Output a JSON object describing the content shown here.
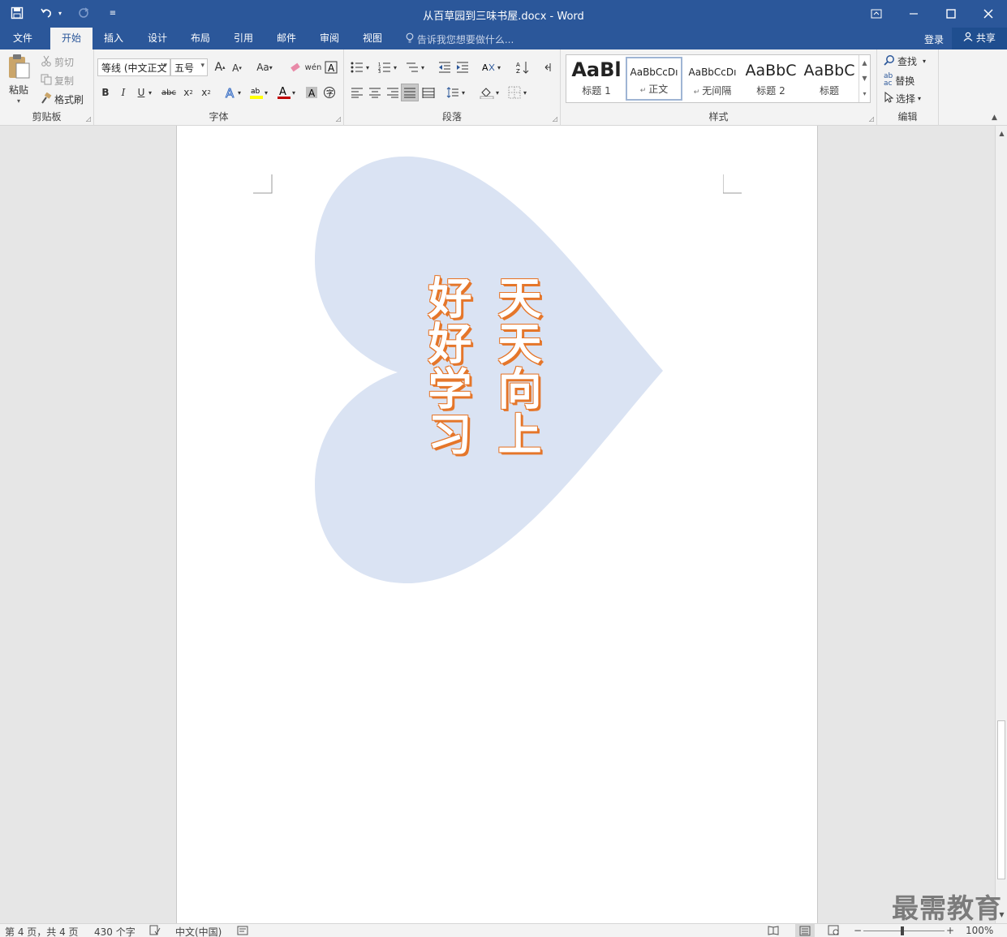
{
  "window": {
    "title": "从百草园到三味书屋.docx - Word",
    "controls": [
      "restore-ribbon",
      "minimize",
      "maximize",
      "close"
    ]
  },
  "qat": {
    "icons": [
      "save-icon",
      "undo-icon",
      "redo-icon",
      "customize-icon"
    ]
  },
  "tabs": [
    {
      "label": "文件"
    },
    {
      "label": "开始"
    },
    {
      "label": "插入"
    },
    {
      "label": "设计"
    },
    {
      "label": "布局"
    },
    {
      "label": "引用"
    },
    {
      "label": "邮件"
    },
    {
      "label": "审阅"
    },
    {
      "label": "视图"
    }
  ],
  "active_tab": "开始",
  "tellme": "告诉我您想要做什么...",
  "account": {
    "login": "登录",
    "share": "共享"
  },
  "clipboard": {
    "paste": "粘贴",
    "cut": "剪切",
    "copy": "复制",
    "format_painter": "格式刷",
    "label": "剪贴板"
  },
  "font": {
    "name": "等线 (中文正文",
    "size": "五号",
    "grow": "A",
    "shrink": "A",
    "case": "Aa",
    "bold": "B",
    "italic": "I",
    "underline": "U",
    "strike": "abc",
    "sub": "x",
    "sup": "x",
    "label": "字体"
  },
  "paragraph": {
    "label": "段落"
  },
  "styles": {
    "label": "样式",
    "items": [
      {
        "sample": "AaBl",
        "name": "标题 1"
      },
      {
        "sample": "AaBbCcDı",
        "name": "正文"
      },
      {
        "sample": "AaBbCcDı",
        "name": "无间隔"
      },
      {
        "sample": "AaBbC",
        "name": "标题 2"
      },
      {
        "sample": "AaBbC",
        "name": "标题"
      }
    ]
  },
  "editing": {
    "find": "查找",
    "replace": "替换",
    "select": "选择",
    "label": "编辑"
  },
  "document": {
    "shape": "heart",
    "shape_color": "#dae3f3",
    "text_color": "#e5762a",
    "columns": [
      "天天向上",
      "好好学习"
    ]
  },
  "status": {
    "page": "第 4 页，共 4 页",
    "words": "430 个字",
    "language": "中文(中国)",
    "zoom": "100%"
  },
  "watermark": "最需教育",
  "colors": {
    "brand": "#2b579a",
    "ribbon": "#f3f3f3",
    "workspace": "#e6e6e6"
  }
}
